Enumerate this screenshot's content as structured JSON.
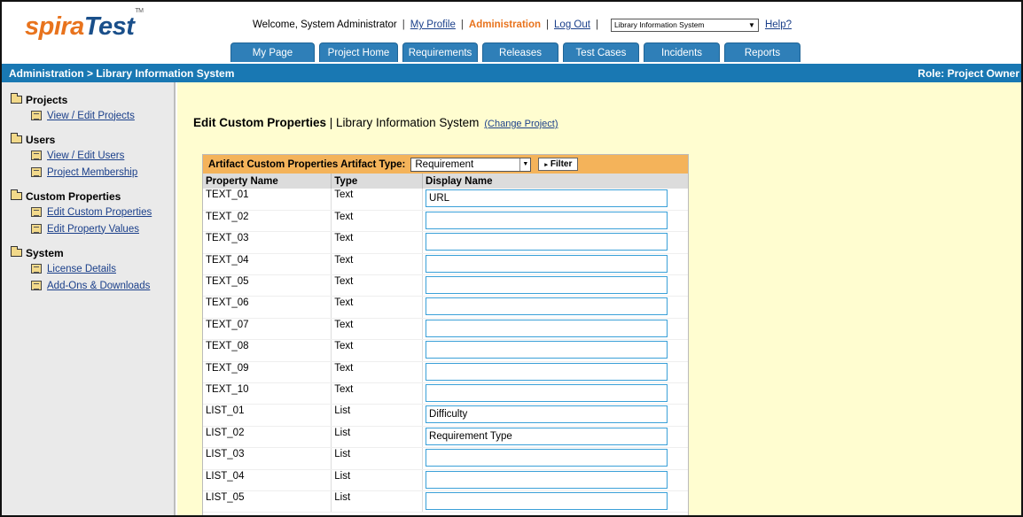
{
  "app": {
    "logo_part1": "spira",
    "logo_part2": "Test",
    "logo_tm": "TM"
  },
  "topbar": {
    "welcome": "Welcome, System Administrator",
    "my_profile": "My Profile",
    "administration": "Administration",
    "log_out": "Log Out",
    "project_selected": "Library Information System",
    "help": "Help?"
  },
  "tabs": [
    {
      "label": "My Page"
    },
    {
      "label": "Project Home"
    },
    {
      "label": "Requirements"
    },
    {
      "label": "Releases"
    },
    {
      "label": "Test Cases"
    },
    {
      "label": "Incidents"
    },
    {
      "label": "Reports"
    }
  ],
  "breadcrumb": {
    "path": "Administration > Library Information System",
    "role": "Role: Project Owner"
  },
  "sidebar": {
    "sections": [
      {
        "title": "Projects",
        "links": [
          "View / Edit Projects"
        ]
      },
      {
        "title": "Users",
        "links": [
          "View / Edit Users",
          "Project Membership"
        ]
      },
      {
        "title": "Custom Properties",
        "links": [
          "Edit Custom Properties",
          "Edit Property Values"
        ]
      },
      {
        "title": "System",
        "links": [
          "License Details",
          "Add-Ons & Downloads"
        ]
      }
    ]
  },
  "main": {
    "heading_bold": "Edit Custom Properties",
    "heading_rest": " | Library Information System",
    "change_project": "(Change Project)",
    "filter": {
      "label": "Artifact Custom Properties Artifact Type:",
      "selected": "Requirement",
      "button": "Filter"
    },
    "columns": [
      "Property Name",
      "Type",
      "Display Name"
    ],
    "rows": [
      {
        "name": "TEXT_01",
        "type": "Text",
        "display": "URL"
      },
      {
        "name": "TEXT_02",
        "type": "Text",
        "display": ""
      },
      {
        "name": "TEXT_03",
        "type": "Text",
        "display": ""
      },
      {
        "name": "TEXT_04",
        "type": "Text",
        "display": ""
      },
      {
        "name": "TEXT_05",
        "type": "Text",
        "display": ""
      },
      {
        "name": "TEXT_06",
        "type": "Text",
        "display": ""
      },
      {
        "name": "TEXT_07",
        "type": "Text",
        "display": ""
      },
      {
        "name": "TEXT_08",
        "type": "Text",
        "display": ""
      },
      {
        "name": "TEXT_09",
        "type": "Text",
        "display": ""
      },
      {
        "name": "TEXT_10",
        "type": "Text",
        "display": ""
      },
      {
        "name": "LIST_01",
        "type": "List",
        "display": "Difficulty"
      },
      {
        "name": "LIST_02",
        "type": "List",
        "display": "Requirement Type"
      },
      {
        "name": "LIST_03",
        "type": "List",
        "display": ""
      },
      {
        "name": "LIST_04",
        "type": "List",
        "display": ""
      },
      {
        "name": "LIST_05",
        "type": "List",
        "display": ""
      }
    ]
  },
  "colors": {
    "brand_orange": "#e8731d",
    "brand_blue": "#1978b3",
    "tab_blue": "#2f7fb8",
    "filter_orange": "#f4b35a",
    "main_bg": "#fffdd0"
  }
}
